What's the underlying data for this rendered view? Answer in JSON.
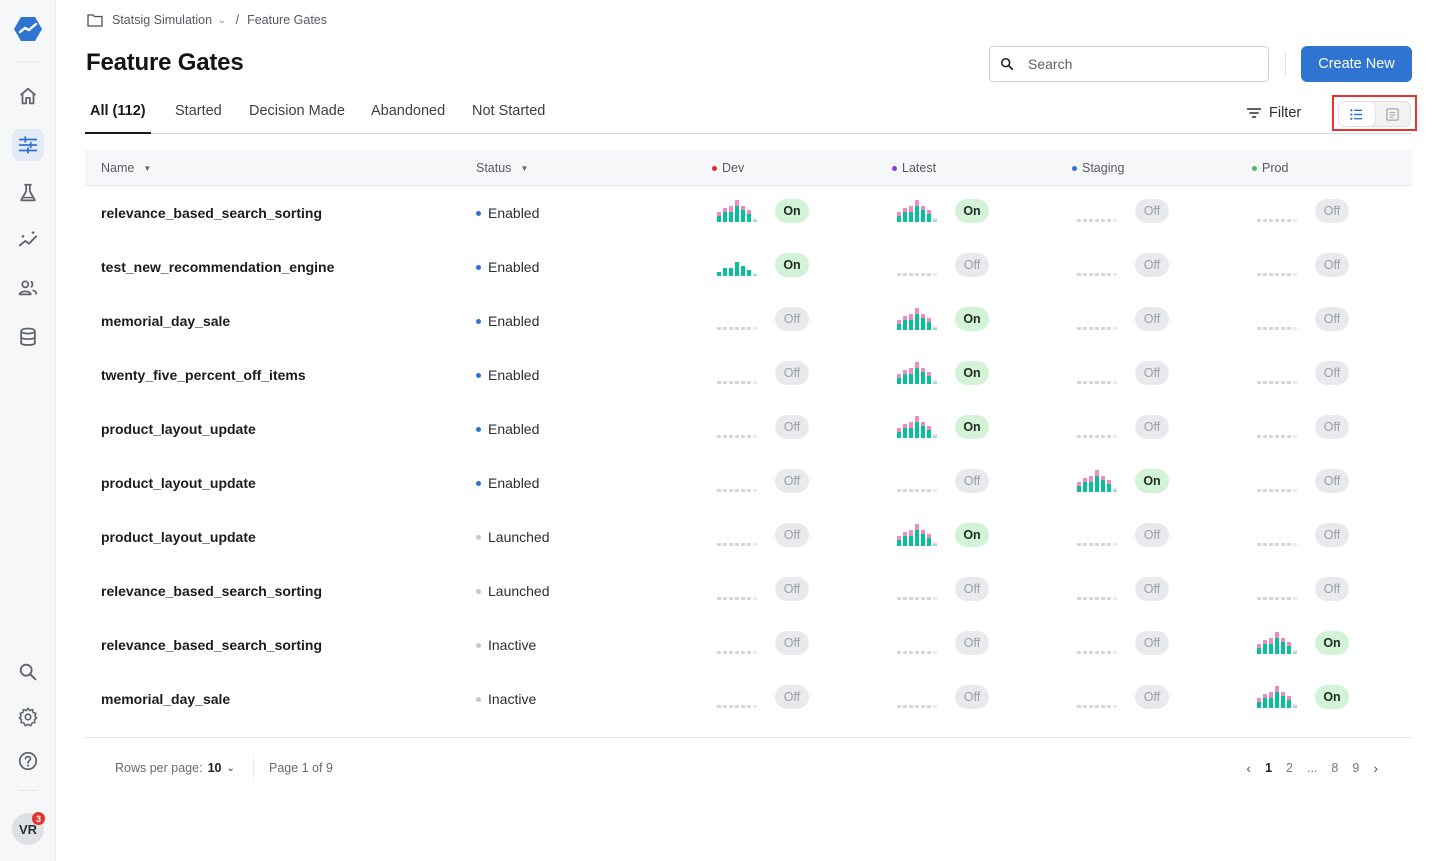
{
  "sidebar": {
    "logo": "statsig-logo-icon",
    "items": [
      {
        "name": "home",
        "icon": "home-icon"
      },
      {
        "name": "feature-gates",
        "icon": "sliders-icon",
        "active": true
      },
      {
        "name": "experiments",
        "icon": "flask-icon"
      },
      {
        "name": "metrics",
        "icon": "sparkline-icon"
      },
      {
        "name": "users",
        "icon": "users-icon"
      },
      {
        "name": "data",
        "icon": "database-icon"
      }
    ],
    "bottom": [
      {
        "name": "search",
        "icon": "search-icon"
      },
      {
        "name": "settings",
        "icon": "gear-icon"
      },
      {
        "name": "help",
        "icon": "help-icon"
      }
    ],
    "avatar": {
      "initials": "VR",
      "notifications": "3"
    }
  },
  "breadcrumb": {
    "project": "Statsig Simulation",
    "separator": "/",
    "current": "Feature Gates"
  },
  "header": {
    "title": "Feature Gates",
    "search_placeholder": "Search",
    "create_label": "Create New"
  },
  "tabs": [
    {
      "label": "All (112)",
      "active": true
    },
    {
      "label": "Started"
    },
    {
      "label": "Decision Made"
    },
    {
      "label": "Abandoned"
    },
    {
      "label": "Not Started"
    }
  ],
  "filter_label": "Filter",
  "view_toggle": {
    "options": [
      "list-view",
      "card-view"
    ],
    "selected": "list-view"
  },
  "columns": {
    "name": "Name",
    "status": "Status",
    "envs": [
      {
        "label": "Dev",
        "color": "#e0282a"
      },
      {
        "label": "Latest",
        "color": "#8a3fd1"
      },
      {
        "label": "Staging",
        "color": "#2f74d0"
      },
      {
        "label": "Prod",
        "color": "#3fbf5f"
      }
    ]
  },
  "status_colors": {
    "Enabled": "#2f74d0",
    "Launched": "#c4c7cc",
    "Inactive": "#c4c7cc"
  },
  "colors": {
    "accent": "#2f74d0",
    "chart_pass": "#08c198",
    "chart_fail": "#ea8dc4",
    "on_bg": "#d3f3d7",
    "off_bg": "#e8eaed"
  },
  "rows": [
    {
      "name": "relevance_based_search_sorting",
      "status": "Enabled",
      "envs": [
        "On",
        "On",
        "Off",
        "Off"
      ],
      "chart": [
        "full",
        "full",
        "empty",
        "empty"
      ]
    },
    {
      "name": "test_new_recommendation_engine",
      "status": "Enabled",
      "envs": [
        "On",
        "Off",
        "Off",
        "Off"
      ],
      "chart": [
        "pass",
        "empty",
        "empty",
        "empty"
      ]
    },
    {
      "name": "memorial_day_sale",
      "status": "Enabled",
      "envs": [
        "Off",
        "On",
        "Off",
        "Off"
      ],
      "chart": [
        "empty",
        "full",
        "empty",
        "empty"
      ]
    },
    {
      "name": "twenty_five_percent_off_items",
      "status": "Enabled",
      "envs": [
        "Off",
        "On",
        "Off",
        "Off"
      ],
      "chart": [
        "empty",
        "full",
        "empty",
        "empty"
      ]
    },
    {
      "name": "product_layout_update",
      "status": "Enabled",
      "envs": [
        "Off",
        "On",
        "Off",
        "Off"
      ],
      "chart": [
        "empty",
        "full",
        "empty",
        "empty"
      ]
    },
    {
      "name": "product_layout_update",
      "status": "Enabled",
      "envs": [
        "Off",
        "Off",
        "On",
        "Off"
      ],
      "chart": [
        "empty",
        "empty",
        "full",
        "empty"
      ]
    },
    {
      "name": "product_layout_update",
      "status": "Launched",
      "envs": [
        "Off",
        "On",
        "Off",
        "Off"
      ],
      "chart": [
        "empty",
        "full",
        "empty",
        "empty"
      ]
    },
    {
      "name": "relevance_based_search_sorting",
      "status": "Launched",
      "envs": [
        "Off",
        "Off",
        "Off",
        "Off"
      ],
      "chart": [
        "empty",
        "empty",
        "empty",
        "empty"
      ]
    },
    {
      "name": "relevance_based_search_sorting",
      "status": "Inactive",
      "envs": [
        "Off",
        "Off",
        "Off",
        "On"
      ],
      "chart": [
        "empty",
        "empty",
        "empty",
        "full"
      ]
    },
    {
      "name": "memorial_day_sale",
      "status": "Inactive",
      "envs": [
        "Off",
        "Off",
        "Off",
        "On"
      ],
      "chart": [
        "empty",
        "empty",
        "empty",
        "full"
      ]
    }
  ],
  "sparklines": {
    "full": {
      "pass": [
        3,
        5,
        5,
        8,
        6,
        4,
        1
      ],
      "fail": [
        2,
        2,
        3,
        3,
        2,
        2,
        1
      ]
    },
    "pass": {
      "pass": [
        2,
        4,
        4,
        7,
        5,
        3,
        1
      ],
      "fail": [
        0,
        0,
        0,
        0,
        0,
        0,
        0
      ]
    },
    "empty": {
      "pass": [
        0,
        0,
        0,
        0,
        0,
        0,
        0
      ],
      "fail": [
        0,
        0,
        0,
        0,
        0,
        0,
        0
      ]
    }
  },
  "footer": {
    "rows_per_page_label": "Rows per page:",
    "rows_per_page": "10",
    "page_info": "Page 1 of 9",
    "pages": [
      "1",
      "2",
      "...",
      "8",
      "9"
    ],
    "current_page": "1"
  }
}
